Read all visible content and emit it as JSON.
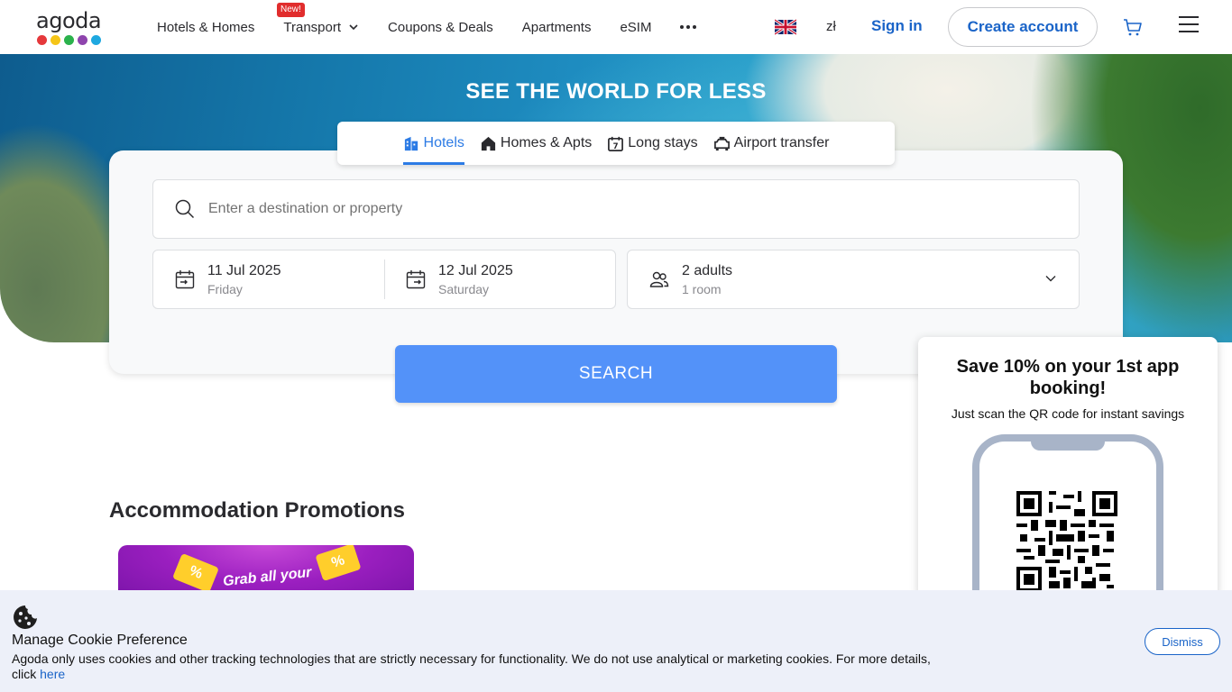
{
  "header": {
    "logo_text": "agoda",
    "logo_dot_colors": [
      "#e5383b",
      "#f5c518",
      "#2bb24c",
      "#8e44ad",
      "#1ea8e0"
    ],
    "nav": [
      {
        "label": "Hotels & Homes"
      },
      {
        "label": "Transport",
        "badge": "New!"
      },
      {
        "label": "Coupons & Deals"
      },
      {
        "label": "Apartments"
      },
      {
        "label": "eSIM"
      }
    ],
    "currency": "zł",
    "sign_in": "Sign in",
    "create_account": "Create account",
    "icons": [
      "uk-flag-icon",
      "cart-icon",
      "hamburger-menu-icon",
      "more-dots-icon"
    ]
  },
  "hero": {
    "title": "SEE THE WORLD FOR LESS"
  },
  "search": {
    "tabs": [
      {
        "label": "Hotels",
        "active": true
      },
      {
        "label": "Homes & Apts"
      },
      {
        "label": "Long stays"
      },
      {
        "label": "Airport transfer"
      }
    ],
    "destination_placeholder": "Enter a destination or property",
    "checkin": {
      "date": "11 Jul 2025",
      "day": "Friday"
    },
    "checkout": {
      "date": "12 Jul 2025",
      "day": "Saturday"
    },
    "guests": {
      "main": "2 adults",
      "sub": "1 room"
    },
    "button": "SEARCH",
    "accent_color": "#5392f9"
  },
  "promotions": {
    "title": "Accommodation Promotions",
    "card_text": "Grab all your"
  },
  "app_promo": {
    "title": "Save 10% on your 1st app booking!",
    "subtitle": "Just scan the QR code for instant savings"
  },
  "cookie": {
    "title": "Manage Cookie Preference",
    "text": "Agoda only uses cookies and other tracking technologies that are strictly necessary for functionality. We do not use analytical or marketing cookies. For more details, click ",
    "link": "here",
    "dismiss": "Dismiss"
  }
}
